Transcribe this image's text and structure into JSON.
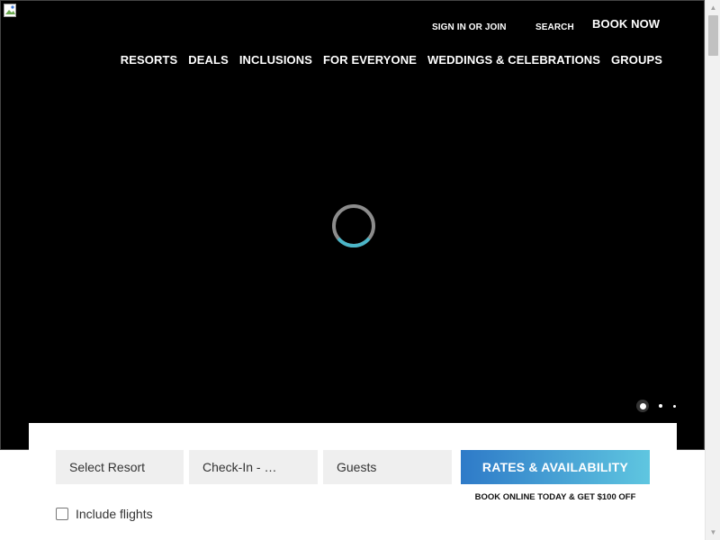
{
  "header": {
    "sign_in_label": "SIGN IN OR JOIN",
    "search_label": "SEARCH",
    "book_now_label": "BOOK NOW"
  },
  "nav": {
    "items": [
      "RESORTS",
      "DEALS",
      "INCLUSIONS",
      "FOR EVERYONE",
      "WEDDINGS & CELEBRATIONS",
      "GROUPS"
    ]
  },
  "hero": {
    "background_color": "#000000",
    "spinner_ring_color": "#8c8c8c",
    "spinner_accent_color": "#4bb6c8",
    "carousel_active_index": 0,
    "carousel_count": 3
  },
  "booking": {
    "resort_field": "Select Resort",
    "checkin_field": "Check-In - …",
    "guests_field": "Guests",
    "rates_button": "RATES & AVAILABILITY",
    "promo_text": "BOOK ONLINE TODAY & GET $100 OFF",
    "include_flights_label": "Include flights",
    "include_flights_checked": false,
    "button_gradient": [
      "#2e7ac8",
      "#5fc6e0"
    ]
  }
}
